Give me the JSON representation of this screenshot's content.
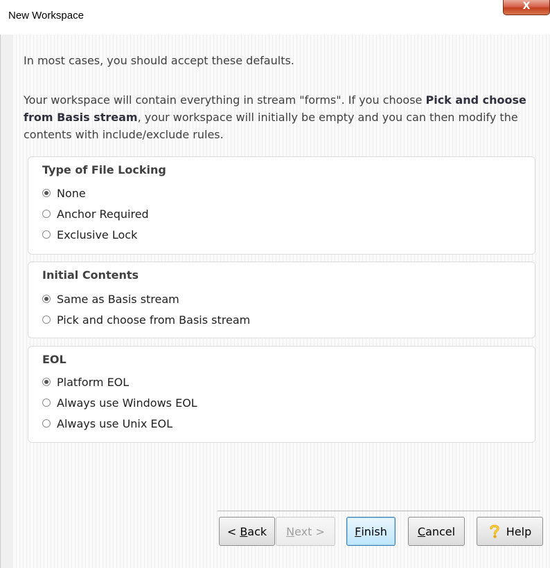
{
  "window": {
    "title": "New Workspace",
    "close_label": "X"
  },
  "intro": "In most cases, you should accept these defaults.",
  "description": {
    "part1": "Your workspace will contain everything in stream \"forms\". If you choose ",
    "bold": "Pick and choose from Basis stream",
    "part2": ", your workspace will initially be empty and you can then modify the contents with include/exclude rules."
  },
  "groups": {
    "locking": {
      "title": "Type of File Locking",
      "options": [
        "None",
        "Anchor Required",
        "Exclusive Lock"
      ],
      "selected": "None"
    },
    "contents": {
      "title": "Initial Contents",
      "options": [
        "Same as Basis stream",
        "Pick and choose from Basis stream"
      ],
      "selected": "Same as Basis stream"
    },
    "eol": {
      "title": "EOL",
      "options": [
        "Platform EOL",
        "Always use Windows EOL",
        "Always use Unix EOL"
      ],
      "selected": "Platform EOL"
    }
  },
  "buttons": {
    "back": {
      "mnemonic": "B",
      "pre": "< ",
      "rest": "ack"
    },
    "next": {
      "mnemonic": "N",
      "rest": "ext >"
    },
    "finish": {
      "mnemonic": "F",
      "rest": "inish"
    },
    "cancel": {
      "mnemonic": "C",
      "rest": "ancel"
    },
    "help": "Help"
  },
  "icons": {
    "help": "question-mark-icon",
    "close": "close-icon"
  },
  "colors": {
    "help_icon": "#f2b700",
    "close_button": "#c74a2c",
    "default_button": "#3c7fb1"
  }
}
